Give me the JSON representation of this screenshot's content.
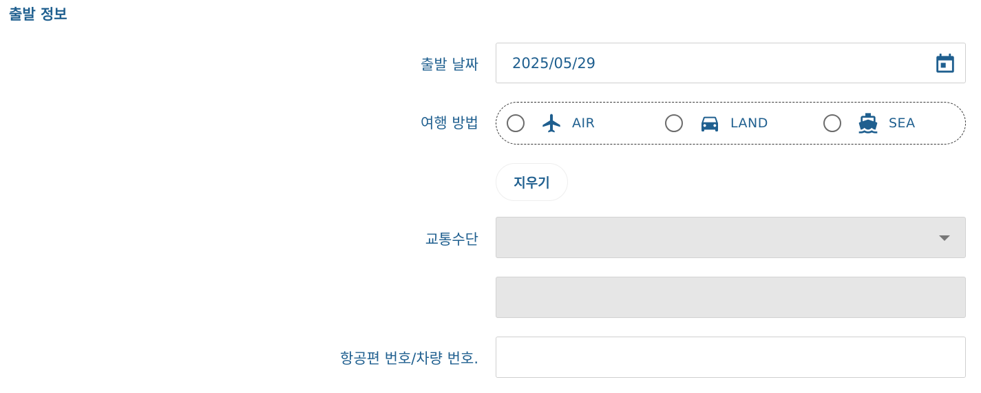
{
  "section": {
    "title": "출발 정보"
  },
  "departure_date": {
    "label": "출발 날짜",
    "value": "2025/05/29",
    "icon": "calendar-icon"
  },
  "travel_method": {
    "label": "여행 방법",
    "options": [
      {
        "label": "AIR",
        "icon": "airplane-icon",
        "selected": false
      },
      {
        "label": "LAND",
        "icon": "car-icon",
        "selected": false
      },
      {
        "label": "SEA",
        "icon": "ship-icon",
        "selected": false
      }
    ]
  },
  "clear_button": {
    "label": "지우기"
  },
  "transport": {
    "label": "교통수단",
    "value": "",
    "disabled": true
  },
  "transport_detail": {
    "value": "",
    "disabled": true
  },
  "vehicle_number": {
    "label": "항공편 번호/차량 번호.",
    "value": ""
  },
  "colors": {
    "primary": "#1f5f8f",
    "disabled_bg": "#e6e6e6",
    "border": "#cfcfcf"
  }
}
